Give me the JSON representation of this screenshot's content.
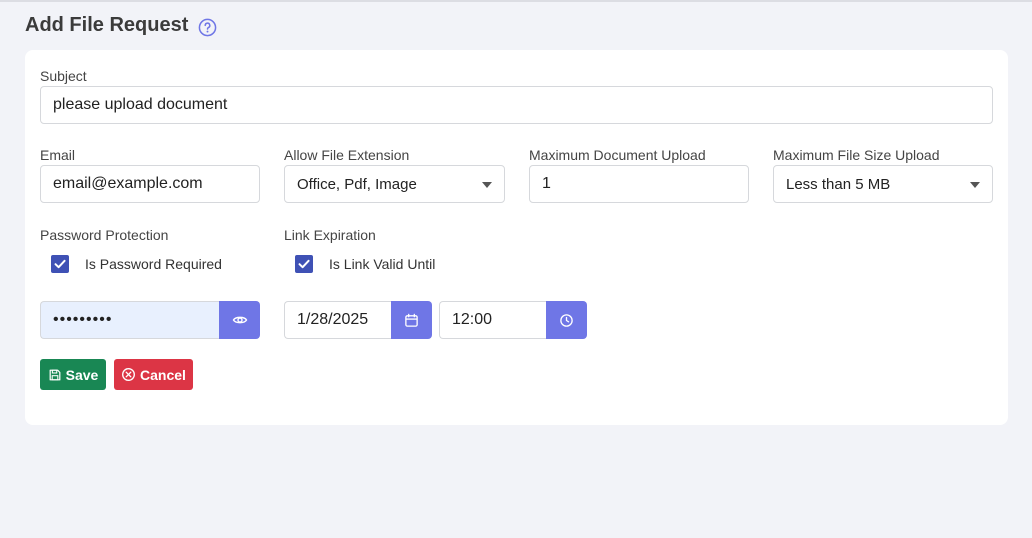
{
  "page": {
    "title": "Add File Request",
    "help_icon": "question-circle-icon"
  },
  "form": {
    "subject": {
      "label": "Subject",
      "value": "please upload document"
    },
    "email": {
      "label": "Email",
      "value": "email@example.com"
    },
    "file_extension": {
      "label": "Allow File Extension",
      "value": "Office, Pdf, Image"
    },
    "max_document": {
      "label": "Maximum Document Upload",
      "value": "1"
    },
    "max_file_size": {
      "label": "Maximum File Size Upload",
      "value": "Less than 5 MB"
    },
    "password_protection": {
      "label": "Password Protection",
      "checkbox_label": "Is Password Required",
      "checked": true,
      "password_value": "•••••••••"
    },
    "link_expiration": {
      "label": "Link Expiration",
      "checkbox_label": "Is Link Valid Until",
      "checked": true,
      "date_value": "1/28/2025",
      "time_value": "12:00"
    },
    "buttons": {
      "save_label": "Save",
      "cancel_label": "Cancel"
    }
  },
  "colors": {
    "accent": "#6f76e6",
    "checkbox": "#3f51b5",
    "save": "#198754",
    "cancel": "#dc3545",
    "background": "#f2f3f8"
  }
}
